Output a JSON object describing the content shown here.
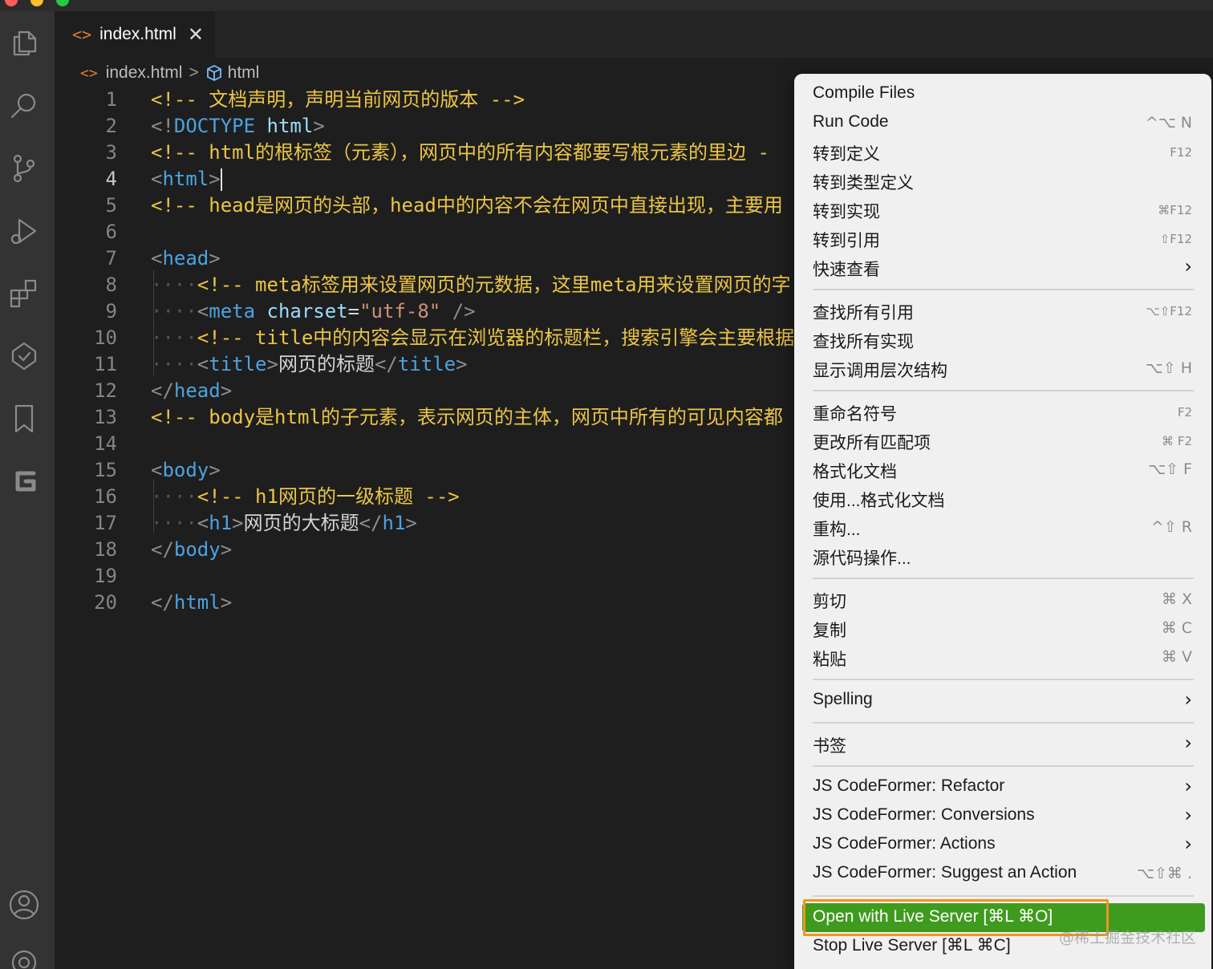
{
  "tab": {
    "icon": "<>",
    "label": "index.html",
    "close": "✕"
  },
  "breadcrumb": {
    "file": "index.html",
    "sep": ">",
    "symbol": "html"
  },
  "editor": {
    "lines": [
      {
        "n": "1"
      },
      {
        "n": "2"
      },
      {
        "n": "3"
      },
      {
        "n": "4"
      },
      {
        "n": "5"
      },
      {
        "n": "6"
      },
      {
        "n": "7"
      },
      {
        "n": "8"
      },
      {
        "n": "9"
      },
      {
        "n": "10"
      },
      {
        "n": "11"
      },
      {
        "n": "12"
      },
      {
        "n": "13"
      },
      {
        "n": "14"
      },
      {
        "n": "15"
      },
      {
        "n": "16"
      },
      {
        "n": "17"
      },
      {
        "n": "18"
      },
      {
        "n": "19"
      },
      {
        "n": "20"
      }
    ],
    "code": {
      "l1": "<!-- 文档声明，声明当前网页的版本 -->",
      "l2_open": "<!",
      "l2_kw": "DOCTYPE",
      "l2_attr": "html",
      "l2_close": ">",
      "l3": "<!-- html的根标签（元素），网页中的所有内容都要写根元素的里边 -",
      "l4_open": "<",
      "l4_tag": "html",
      "l4_close": ">",
      "l5": "<!-- head是网页的头部，head中的内容不会在网页中直接出现，主要用",
      "l7_open": "<",
      "l7_tag": "head",
      "l7_close": ">",
      "indent": "····",
      "l8": "<!-- meta标签用来设置网页的元数据，这里meta用来设置网页的字",
      "l9_open": "<",
      "l9_tag": "meta",
      "l9_attr": "charset",
      "l9_eq": "=",
      "l9_str": "\"utf-8\"",
      "l9_close": " />",
      "l10": "<!-- title中的内容会显示在浏览器的标题栏，搜索引擎会主要根据",
      "l11_open": "<",
      "l11_tag": "title",
      "l11_mid": ">",
      "l11_text": "网页的标题",
      "l11_end_open": "</",
      "l11_end_tag": "title",
      "l11_end_close": ">",
      "l12_open": "</",
      "l12_tag": "head",
      "l12_close": ">",
      "l13": "<!-- body是html的子元素，表示网页的主体，网页中所有的可见内容都",
      "l15_open": "<",
      "l15_tag": "body",
      "l15_close": ">",
      "l16": "<!-- h1网页的一级标题 -->",
      "l17_open": "<",
      "l17_tag": "h1",
      "l17_mid": ">",
      "l17_text": "网页的大标题",
      "l17_end_open": "</",
      "l17_end_tag": "h1",
      "l17_end_close": ">",
      "l18_open": "</",
      "l18_tag": "body",
      "l18_close": ">",
      "l20_open": "</",
      "l20_tag": "html",
      "l20_close": ">"
    }
  },
  "menu": {
    "items": [
      {
        "label": "Compile Files",
        "shortcut": ""
      },
      {
        "label": "Run Code",
        "shortcut": "^⌥ N"
      },
      {
        "label": "转到定义",
        "shortcut": "F12"
      },
      {
        "label": "转到类型定义",
        "shortcut": ""
      },
      {
        "label": "转到实现",
        "shortcut": "⌘F12"
      },
      {
        "label": "转到引用",
        "shortcut": "⇧F12"
      },
      {
        "label": "快速查看",
        "shortcut": "›"
      },
      {
        "label": "查找所有引用",
        "shortcut": "⌥⇧F12"
      },
      {
        "label": "查找所有实现",
        "shortcut": ""
      },
      {
        "label": "显示调用层次结构",
        "shortcut": "⌥⇧ H"
      },
      {
        "label": "重命名符号",
        "shortcut": "F2"
      },
      {
        "label": "更改所有匹配项",
        "shortcut": "⌘ F2"
      },
      {
        "label": "格式化文档",
        "shortcut": "⌥⇧ F"
      },
      {
        "label": "使用...格式化文档",
        "shortcut": ""
      },
      {
        "label": "重构...",
        "shortcut": "^⇧ R"
      },
      {
        "label": "源代码操作...",
        "shortcut": ""
      },
      {
        "label": "剪切",
        "shortcut": "⌘ X"
      },
      {
        "label": "复制",
        "shortcut": "⌘ C"
      },
      {
        "label": "粘贴",
        "shortcut": "⌘ V"
      },
      {
        "label": "Spelling",
        "shortcut": "›"
      },
      {
        "label": "书签",
        "shortcut": "›"
      },
      {
        "label": "JS CodeFormer: Refactor",
        "shortcut": "›"
      },
      {
        "label": "JS CodeFormer: Conversions",
        "shortcut": "›"
      },
      {
        "label": "JS CodeFormer: Actions",
        "shortcut": "›"
      },
      {
        "label": "JS CodeFormer: Suggest an Action",
        "shortcut": "⌥⇧⌘ ."
      },
      {
        "label": "Open with Live Server [⌘L ⌘O]",
        "shortcut": ""
      },
      {
        "label": "Stop Live Server [⌘L ⌘C]",
        "shortcut": ""
      }
    ]
  },
  "watermark": "@稀土掘金技术社区",
  "colors": {
    "editor_bg": "#1e1e1e",
    "activity_bg": "#333333",
    "menu_bg": "#f0f0f0",
    "highlight": "#3f9b1e",
    "highlight_outline": "#f2941f",
    "comment": "#ebc546",
    "tag": "#4ba3e0"
  }
}
